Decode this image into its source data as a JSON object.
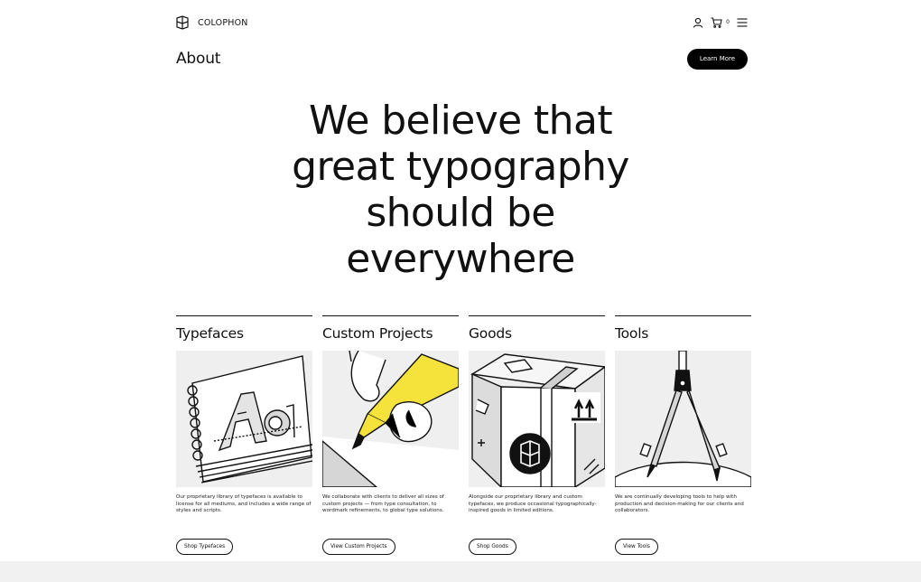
{
  "header": {
    "brand": "COLOPHON",
    "cart_count": "0",
    "icons": [
      "colophon-logo-icon",
      "user-icon",
      "cart-icon",
      "menu-icon"
    ]
  },
  "subheader": {
    "title": "About",
    "learn_more": "Learn More"
  },
  "hero": {
    "lines": [
      "We believe that",
      "great typography",
      "should be",
      "everywhere"
    ]
  },
  "cards": [
    {
      "title": "Typefaces",
      "description": "Our proprietary library of typefaces is available to license for all mediums, and includes a wide range of styles and scripts.",
      "button": "Shop Typefaces",
      "illustration": "typefaces-sketchbook-illustration"
    },
    {
      "title": "Custom Projects",
      "description": "We collaborate with clients to deliver all sizes of custom projects — from type consultation, to wordmark refinements, to global type solutions.",
      "button": "View Custom Projects",
      "illustration": "pen-hand-illustration"
    },
    {
      "title": "Goods",
      "description": "Alongside our proprietary library and custom typefaces, we produce occasional typographically-inspired goods in limited editions.",
      "button": "Shop Goods",
      "illustration": "shipping-box-illustration"
    },
    {
      "title": "Tools",
      "description": "We are continually developing tools to help with production and decision-making for our clients and collaborators.",
      "button": "View Tools",
      "illustration": "compass-illustration"
    }
  ],
  "colors": {
    "accent_yellow": "#f5e23b",
    "ink": "#111111",
    "panel": "#efefef",
    "footer": "#f1f1f1"
  }
}
